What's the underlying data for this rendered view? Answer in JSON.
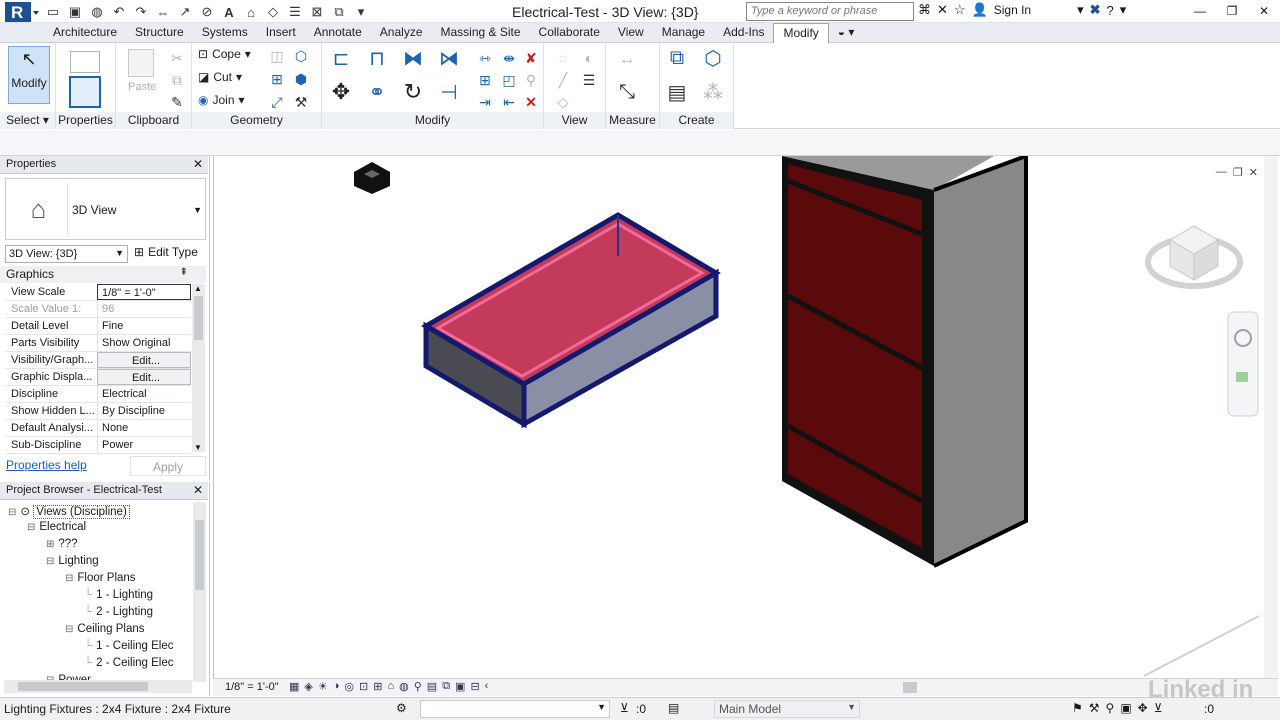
{
  "app": {
    "title": "Electrical-Test - 3D View: {3D}",
    "search_placeholder": "Type a keyword or phrase",
    "sign_in": "Sign In",
    "logo_letter": "R"
  },
  "tabs": [
    "Architecture",
    "Structure",
    "Systems",
    "Insert",
    "Annotate",
    "Analyze",
    "Massing & Site",
    "Collaborate",
    "View",
    "Manage",
    "Add-Ins",
    "Modify"
  ],
  "active_tab": "Modify",
  "ribbon": {
    "select": {
      "label": "Select",
      "modify": "Modify"
    },
    "properties": {
      "label": "Properties"
    },
    "clipboard": {
      "label": "Clipboard",
      "paste": "Paste"
    },
    "geometry": {
      "label": "Geometry",
      "cope": "Cope",
      "cut": "Cut",
      "join": "Join"
    },
    "modify": {
      "label": "Modify"
    },
    "view": {
      "label": "View"
    },
    "measure": {
      "label": "Measure"
    },
    "create": {
      "label": "Create"
    }
  },
  "properties": {
    "title": "Properties",
    "type_name": "3D View",
    "selector": "3D View: {3D}",
    "edit_type": "Edit Type",
    "group": "Graphics",
    "rows": [
      {
        "k": "View Scale",
        "v": "1/8\" = 1'-0\""
      },
      {
        "k": "Scale Value    1:",
        "v": "96"
      },
      {
        "k": "Detail Level",
        "v": "Fine"
      },
      {
        "k": "Parts Visibility",
        "v": "Show Original"
      },
      {
        "k": "Visibility/Graph...",
        "v": "Edit..."
      },
      {
        "k": "Graphic Displa...",
        "v": "Edit..."
      },
      {
        "k": "Discipline",
        "v": "Electrical"
      },
      {
        "k": "Show Hidden L...",
        "v": "By Discipline"
      },
      {
        "k": "Default Analysi...",
        "v": "None"
      },
      {
        "k": "Sub-Discipline",
        "v": "Power"
      }
    ],
    "help": "Properties help",
    "apply": "Apply"
  },
  "browser": {
    "title": "Project Browser - Electrical-Test",
    "items": [
      {
        "label": "Views (Discipline)",
        "level": 0,
        "toggle": "−"
      },
      {
        "label": "Electrical",
        "level": 1,
        "toggle": "−"
      },
      {
        "label": "???",
        "level": 2,
        "toggle": "+"
      },
      {
        "label": "Lighting",
        "level": 2,
        "toggle": "−"
      },
      {
        "label": "Floor Plans",
        "level": 3,
        "toggle": "−"
      },
      {
        "label": "1 - Lighting",
        "level": 4,
        "toggle": ""
      },
      {
        "label": "2 - Lighting",
        "level": 4,
        "toggle": ""
      },
      {
        "label": "Ceiling Plans",
        "level": 3,
        "toggle": "−"
      },
      {
        "label": "1 - Ceiling Elec",
        "level": 4,
        "toggle": ""
      },
      {
        "label": "2 - Ceiling Elec",
        "level": 4,
        "toggle": ""
      },
      {
        "label": "Power",
        "level": 2,
        "toggle": "−"
      }
    ]
  },
  "view_control": {
    "scale": "1/8\" = 1'-0\""
  },
  "status": {
    "text": "Lighting Fixtures : 2x4 Fixture : 2x4 Fixture",
    "select_count": ":0",
    "model": "Main Model",
    "right_count": ":0"
  },
  "watermark": "Linked in"
}
